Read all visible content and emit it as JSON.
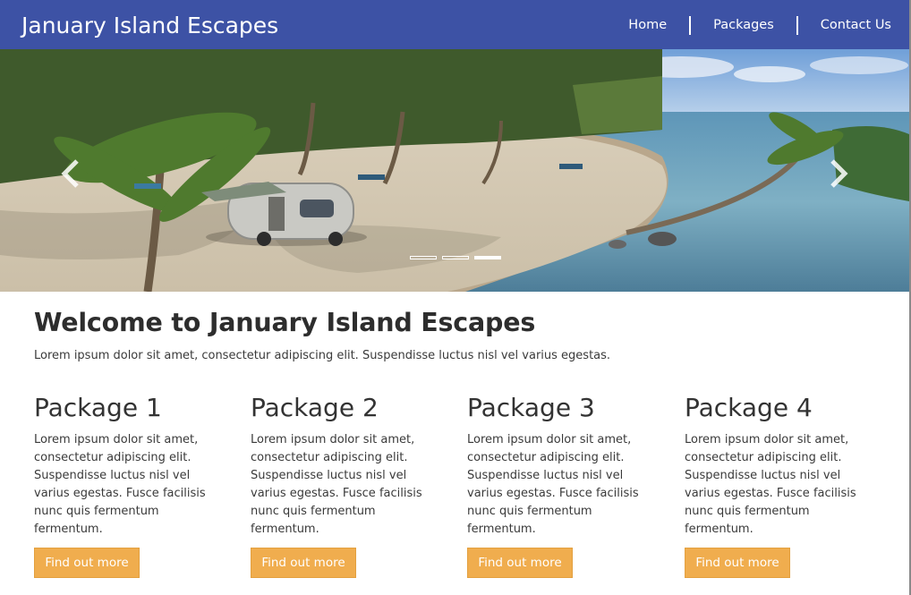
{
  "header": {
    "brand": "January Island Escapes",
    "nav": [
      {
        "label": "Home"
      },
      {
        "label": "Packages"
      },
      {
        "label": "Contact Us"
      }
    ],
    "background": "#3d52a5"
  },
  "carousel": {
    "slide_count": 3,
    "active_slide": 3,
    "prev_icon": "chevron-left-icon",
    "next_icon": "chevron-right-icon"
  },
  "welcome": {
    "title": "Welcome to January Island Escapes",
    "text": "Lorem ipsum dolor sit amet, consectetur adipiscing elit. Suspendisse luctus nisl vel varius egestas."
  },
  "packages": [
    {
      "title": "Package 1",
      "text": "Lorem ipsum dolor sit amet, consectetur adipiscing elit. Suspendisse luctus nisl vel varius egestas. Fusce facilisis nunc quis fermentum fermentum.",
      "button": "Find out more"
    },
    {
      "title": "Package 2",
      "text": "Lorem ipsum dolor sit amet, consectetur adipiscing elit. Suspendisse luctus nisl vel varius egestas. Fusce facilisis nunc quis fermentum fermentum.",
      "button": "Find out more"
    },
    {
      "title": "Package 3",
      "text": "Lorem ipsum dolor sit amet, consectetur adipiscing elit. Suspendisse luctus nisl vel varius egestas. Fusce facilisis nunc quis fermentum fermentum.",
      "button": "Find out more"
    },
    {
      "title": "Package 4",
      "text": "Lorem ipsum dolor sit amet, consectetur adipiscing elit. Suspendisse luctus nisl vel varius egestas. Fusce facilisis nunc quis fermentum fermentum.",
      "button": "Find out more"
    }
  ],
  "colors": {
    "button": "#f0ad4e",
    "header": "#3d52a5"
  }
}
